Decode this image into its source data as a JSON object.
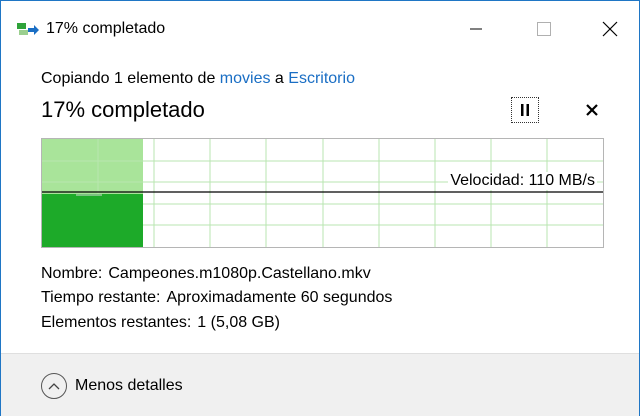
{
  "window": {
    "title": "17% completado",
    "icon": "copy-progress-icon"
  },
  "copy": {
    "prefix": "Copiando 1 elemento de ",
    "source": "movies",
    "connector": " a ",
    "destination": "Escritorio"
  },
  "progress": {
    "title": "17% completado",
    "percent": 17
  },
  "controls": {
    "pause_icon": "pause-icon",
    "cancel_icon": "close-icon"
  },
  "graph": {
    "speed_text": "Velocidad: 110 MB/s"
  },
  "details": {
    "name_label": "Nombre:",
    "name_value": "Campeones.m1080p.Castellano.mkv",
    "time_label": "Tiempo restante:",
    "time_value": "Aproximadamente 60 segundos",
    "items_label": "Elementos restantes:",
    "items_value": "1 (5,08 GB)"
  },
  "footer": {
    "less_details": "Menos detalles"
  },
  "colors": {
    "accent_border": "#1f76c5",
    "progress_light": "#a9e49a",
    "progress_dark": "#1daa29",
    "grid": "#b9e6b0",
    "link": "#1a6ec4"
  }
}
